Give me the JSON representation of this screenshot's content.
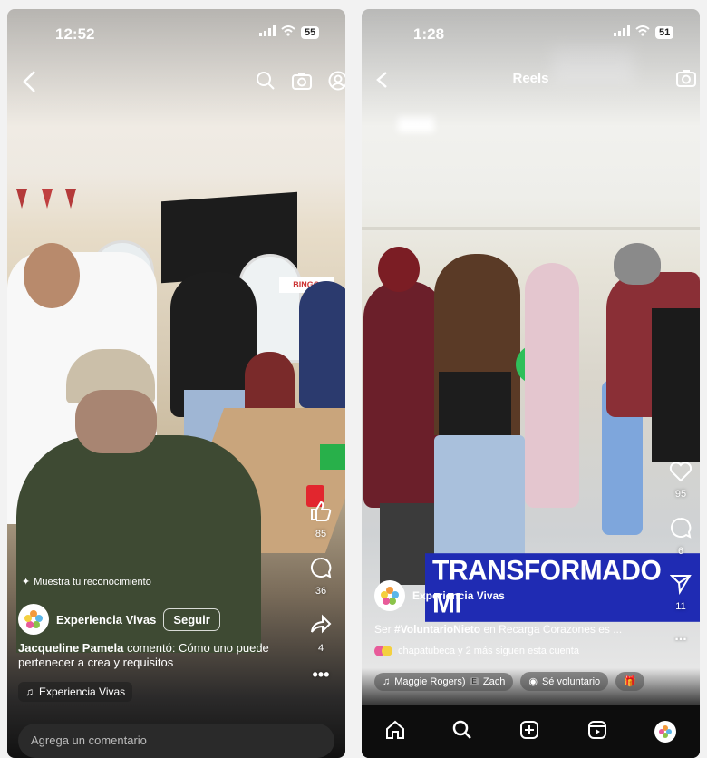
{
  "left": {
    "status": {
      "time": "12:52",
      "battery": "55"
    },
    "sidebar": {
      "likes": "85",
      "comments": "36",
      "shares": "4"
    },
    "recognition": "Muestra tu reconocimiento",
    "account": {
      "name": "Experiencia Vivas",
      "follow_label": "Seguir"
    },
    "comment": {
      "author": "Jacqueline Pamela",
      "text": " comentó: Cómo uno puede pertenecer a crea y requisitos"
    },
    "audio": "Experiencia Vivas",
    "comment_placeholder": "Agrega un comentario",
    "photo_sign": "BINGO"
  },
  "right": {
    "status": {
      "time": "1:28",
      "battery": "51"
    },
    "title": "Reels",
    "banner": "TRANSFORMADO MI",
    "account": {
      "name": "Experiencia Vivas"
    },
    "caption": {
      "prefix": "Ser ",
      "hashtag": "#VoluntarioNieto",
      "rest": " en Recarga Corazones es ..."
    },
    "followers_note": "chapatubeca y 2 más siguen esta cuenta",
    "audio": "Maggie Rogers)",
    "audio_more": "Zach",
    "volunteer_label": "Sé voluntario",
    "sidebar": {
      "likes": "95",
      "comments": "6",
      "shares": "11"
    },
    "more": "..."
  },
  "colors": {
    "banner": "#1f2bb3",
    "green_balloon": "#2fbf5a"
  }
}
